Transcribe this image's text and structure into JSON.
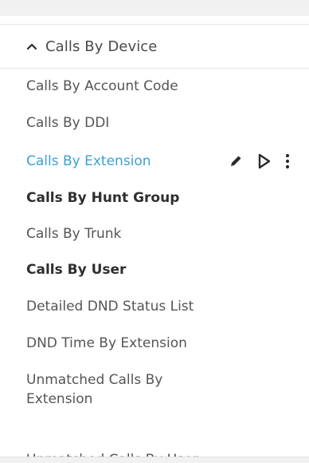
{
  "section": {
    "title": "Calls By Device",
    "icon": "chevron-up-icon"
  },
  "reports": [
    {
      "label": "Calls By Account Code",
      "style": "normal"
    },
    {
      "label": "Calls By DDI",
      "style": "normal"
    },
    {
      "label": "Calls By Extension",
      "style": "active"
    },
    {
      "label": "Calls By Hunt Group",
      "style": "bold"
    },
    {
      "label": "Calls By Trunk",
      "style": "normal"
    },
    {
      "label": "Calls By User",
      "style": "bold"
    },
    {
      "label": "Detailed DND Status List",
      "style": "normal"
    },
    {
      "label": "DND Time By Extension",
      "style": "normal"
    },
    {
      "label": "Unmatched Calls By Extension",
      "style": "normal"
    },
    {
      "label": "Unmatched Calls By User",
      "style": "normal"
    }
  ],
  "row_actions": {
    "edit_icon": "pencil-icon",
    "run_icon": "play-icon",
    "more_icon": "more-vertical-icon"
  },
  "colors": {
    "active_text": "#3ba0d8",
    "icon": "#2b2b2b",
    "text": "#555555"
  }
}
